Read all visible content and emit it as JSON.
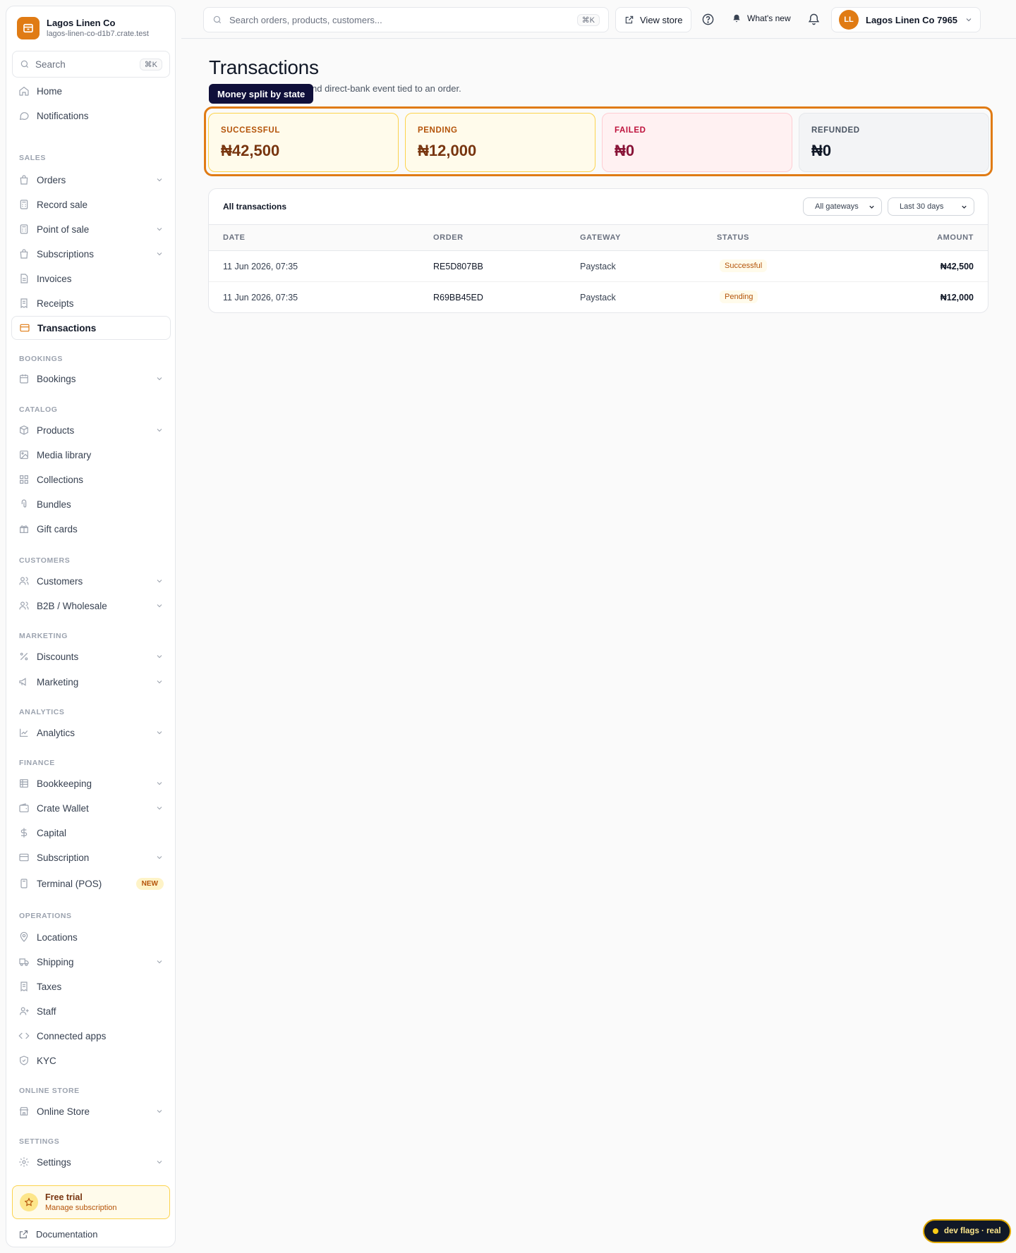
{
  "brand": {
    "name": "Lagos Linen Co",
    "url": "lagos-linen-co-d1b7.crate.test"
  },
  "sidebar_search": {
    "placeholder": "Search",
    "shortcut": "⌘K"
  },
  "nav": {
    "home": "Home",
    "notifications": "Notifications",
    "sections": {
      "sales": "SALES",
      "bookings": "BOOKINGS",
      "catalog": "CATALOG",
      "customers": "CUSTOMERS",
      "marketing": "MARKETING",
      "analytics": "ANALYTICS",
      "finance": "FINANCE",
      "operations": "OPERATIONS",
      "online_store": "ONLINE STORE",
      "settings": "SETTINGS"
    },
    "items": {
      "orders": "Orders",
      "record_sale": "Record sale",
      "point_of_sale": "Point of sale",
      "subscriptions": "Subscriptions",
      "invoices": "Invoices",
      "receipts": "Receipts",
      "transactions": "Transactions",
      "bookings": "Bookings",
      "products": "Products",
      "media_library": "Media library",
      "collections": "Collections",
      "bundles": "Bundles",
      "gift_cards": "Gift cards",
      "customers": "Customers",
      "b2b": "B2B / Wholesale",
      "discounts": "Discounts",
      "marketing": "Marketing",
      "analytics": "Analytics",
      "bookkeeping": "Bookkeeping",
      "crate_wallet": "Crate Wallet",
      "capital": "Capital",
      "subscription": "Subscription",
      "terminal": "Terminal (POS)",
      "terminal_badge": "NEW",
      "locations": "Locations",
      "shipping": "Shipping",
      "taxes": "Taxes",
      "staff": "Staff",
      "connected_apps": "Connected apps",
      "kyc": "KYC",
      "online_store": "Online Store",
      "settings": "Settings"
    }
  },
  "trial": {
    "title": "Free trial",
    "subtitle": "Manage subscription"
  },
  "documentation": "Documentation",
  "topbar": {
    "search_placeholder": "Search orders, products, customers...",
    "search_shortcut": "⌘K",
    "view_store": "View store",
    "whats_new": "What's new",
    "account_initials": "LL",
    "account_name": "Lagos Linen Co 7965"
  },
  "page": {
    "title": "Transactions",
    "subtitle_visible": "nd direct-bank event tied to an order.",
    "tooltip": "Money split by state"
  },
  "stats": [
    {
      "label": "SUCCESSFUL",
      "value": "₦42,500"
    },
    {
      "label": "PENDING",
      "value": "₦12,000"
    },
    {
      "label": "FAILED",
      "value": "₦0"
    },
    {
      "label": "REFUNDED",
      "value": "₦0"
    }
  ],
  "table": {
    "title": "All transactions",
    "gateway_filter": "All gateways",
    "date_filter": "Last 30 days",
    "columns": {
      "date": "DATE",
      "order": "ORDER",
      "gateway": "GATEWAY",
      "status": "STATUS",
      "amount": "AMOUNT"
    },
    "rows": [
      {
        "date": "11 Jun 2026, 07:35",
        "order": "RE5D807BB",
        "gateway": "Paystack",
        "status": "Successful",
        "amount": "₦42,500"
      },
      {
        "date": "11 Jun 2026, 07:35",
        "order": "R69BB45ED",
        "gateway": "Paystack",
        "status": "Pending",
        "amount": "₦12,000"
      }
    ]
  },
  "dev_flags": "dev flags · real",
  "colors": {
    "accent": "#e07b14",
    "tooltip_bg": "#0f0f3a"
  }
}
